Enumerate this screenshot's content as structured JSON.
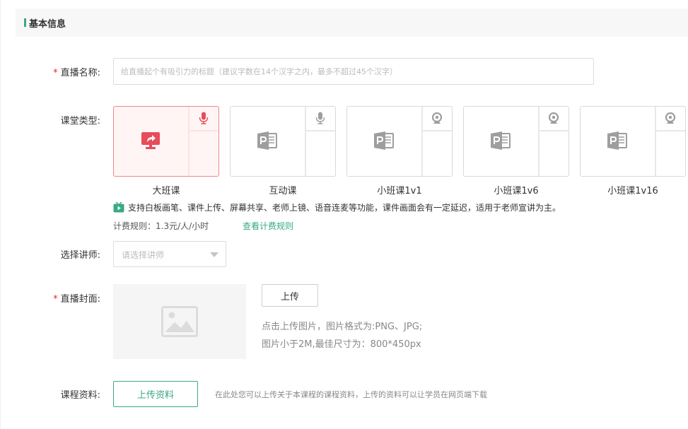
{
  "section": {
    "title": "基本信息"
  },
  "form": {
    "required_mark": "*",
    "live_name": {
      "label": "直播名称:",
      "placeholder": "给直播起个有吸引力的标题（建议字数在14个汉字之内，最多不超过45个汉字）",
      "value": ""
    },
    "class_type": {
      "label": "课堂类型:",
      "options": [
        {
          "label": "大班课",
          "selected": true,
          "side_icon": "microphone-icon",
          "main_icon": "screen-share-icon"
        },
        {
          "label": "互动课",
          "selected": false,
          "side_icon": "microphone-icon",
          "main_icon": "ppt-icon"
        },
        {
          "label": "小班课1v1",
          "selected": false,
          "side_icon": "webcam-icon",
          "main_icon": "ppt-icon"
        },
        {
          "label": "小班课1v6",
          "selected": false,
          "side_icon": "webcam-icon",
          "main_icon": "ppt-icon"
        },
        {
          "label": "小班课1v16",
          "selected": false,
          "side_icon": "webcam-icon",
          "main_icon": "ppt-icon"
        }
      ],
      "description": "支持白板画笔、课件上传、屏幕共享、老师上镜、语音连麦等功能，课件画面会有一定延迟，适用于老师宣讲为主。",
      "fee_rule": "计费规则：1.3元/人/小时",
      "fee_link": "查看计费规则"
    },
    "teacher": {
      "label": "选择讲师:",
      "placeholder": "请选择讲师"
    },
    "cover": {
      "label": "直播封面:",
      "upload_label": "上传",
      "hint_line1": "点击上传图片，图片格式为:PNG、JPG;",
      "hint_line2": "图片小于2M,最佳尺寸为：800*450px"
    },
    "materials": {
      "label": "课程资料:",
      "upload_label": "上传资料",
      "hint": "在此处您可以上传关于本课程的课程资料，上传的资料可以让学员在网页端下载"
    }
  },
  "colors": {
    "accent": "#37a985",
    "required": "#f5222d",
    "selected_border": "#f0868c",
    "selected_bg": "#fff5f5",
    "selected_icon": "#e84b5a",
    "icon_gray": "#9e9e9e"
  }
}
